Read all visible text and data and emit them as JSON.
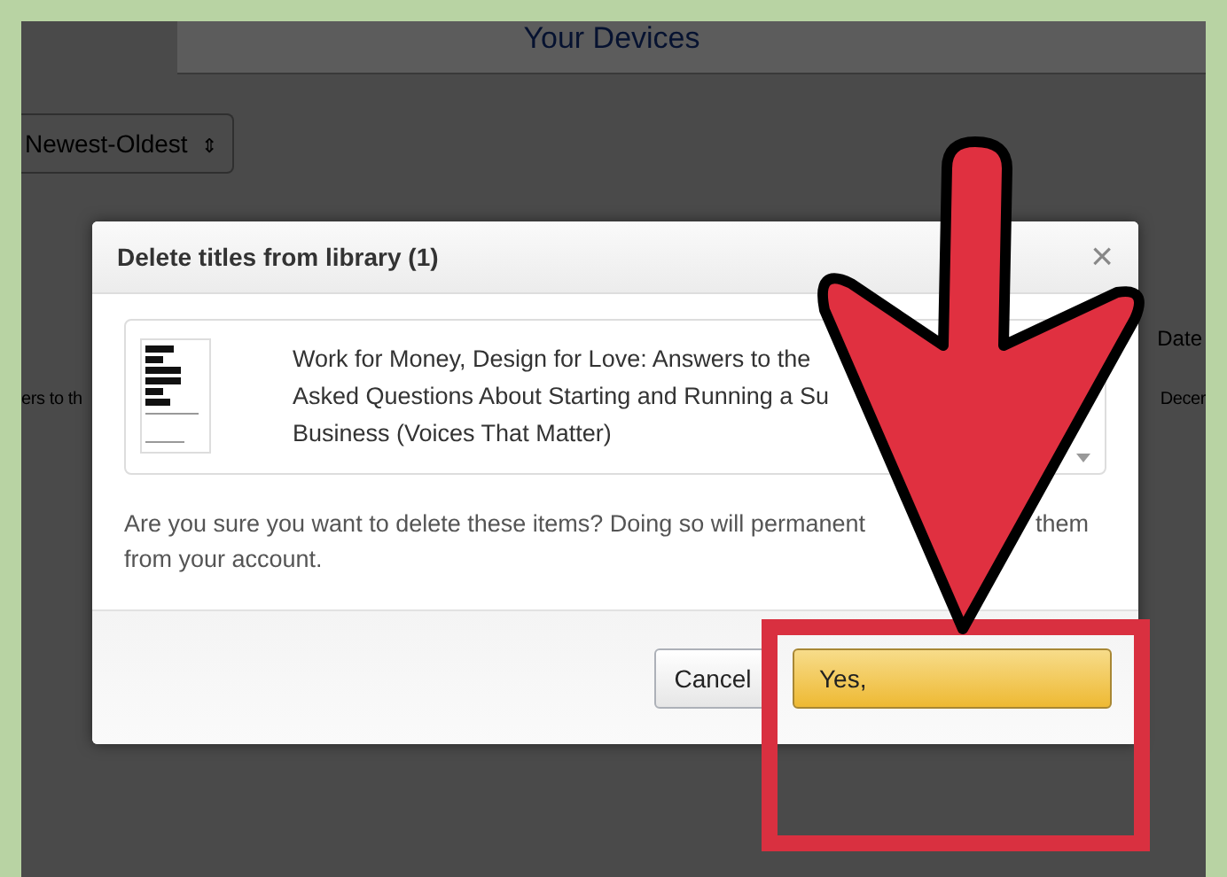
{
  "page": {
    "heading": "Your Devices",
    "sort": {
      "label": "Newest-Oldest",
      "icon": "⇕"
    },
    "column_heading": "Date",
    "row": {
      "column_1": "ers to th",
      "column_2": "Decer"
    }
  },
  "dialog": {
    "title": "Delete titles from library (1)",
    "close": "×",
    "item": {
      "title_lines": [
        "Work for Money, Design for Love: Answers to the",
        "Asked Questions About Starting and Running a Su",
        "Business (Voices That Matter)"
      ]
    },
    "message_lines": [
      {
        "parts": [
          "Are you sure you want to delete these items? Doing so will permanent",
          "them"
        ]
      },
      {
        "parts": [
          "from your account."
        ]
      }
    ],
    "buttons": [
      {
        "label": "Cancel",
        "kind": "secondary"
      },
      {
        "label": "Yes,",
        "kind": "primary"
      }
    ]
  }
}
